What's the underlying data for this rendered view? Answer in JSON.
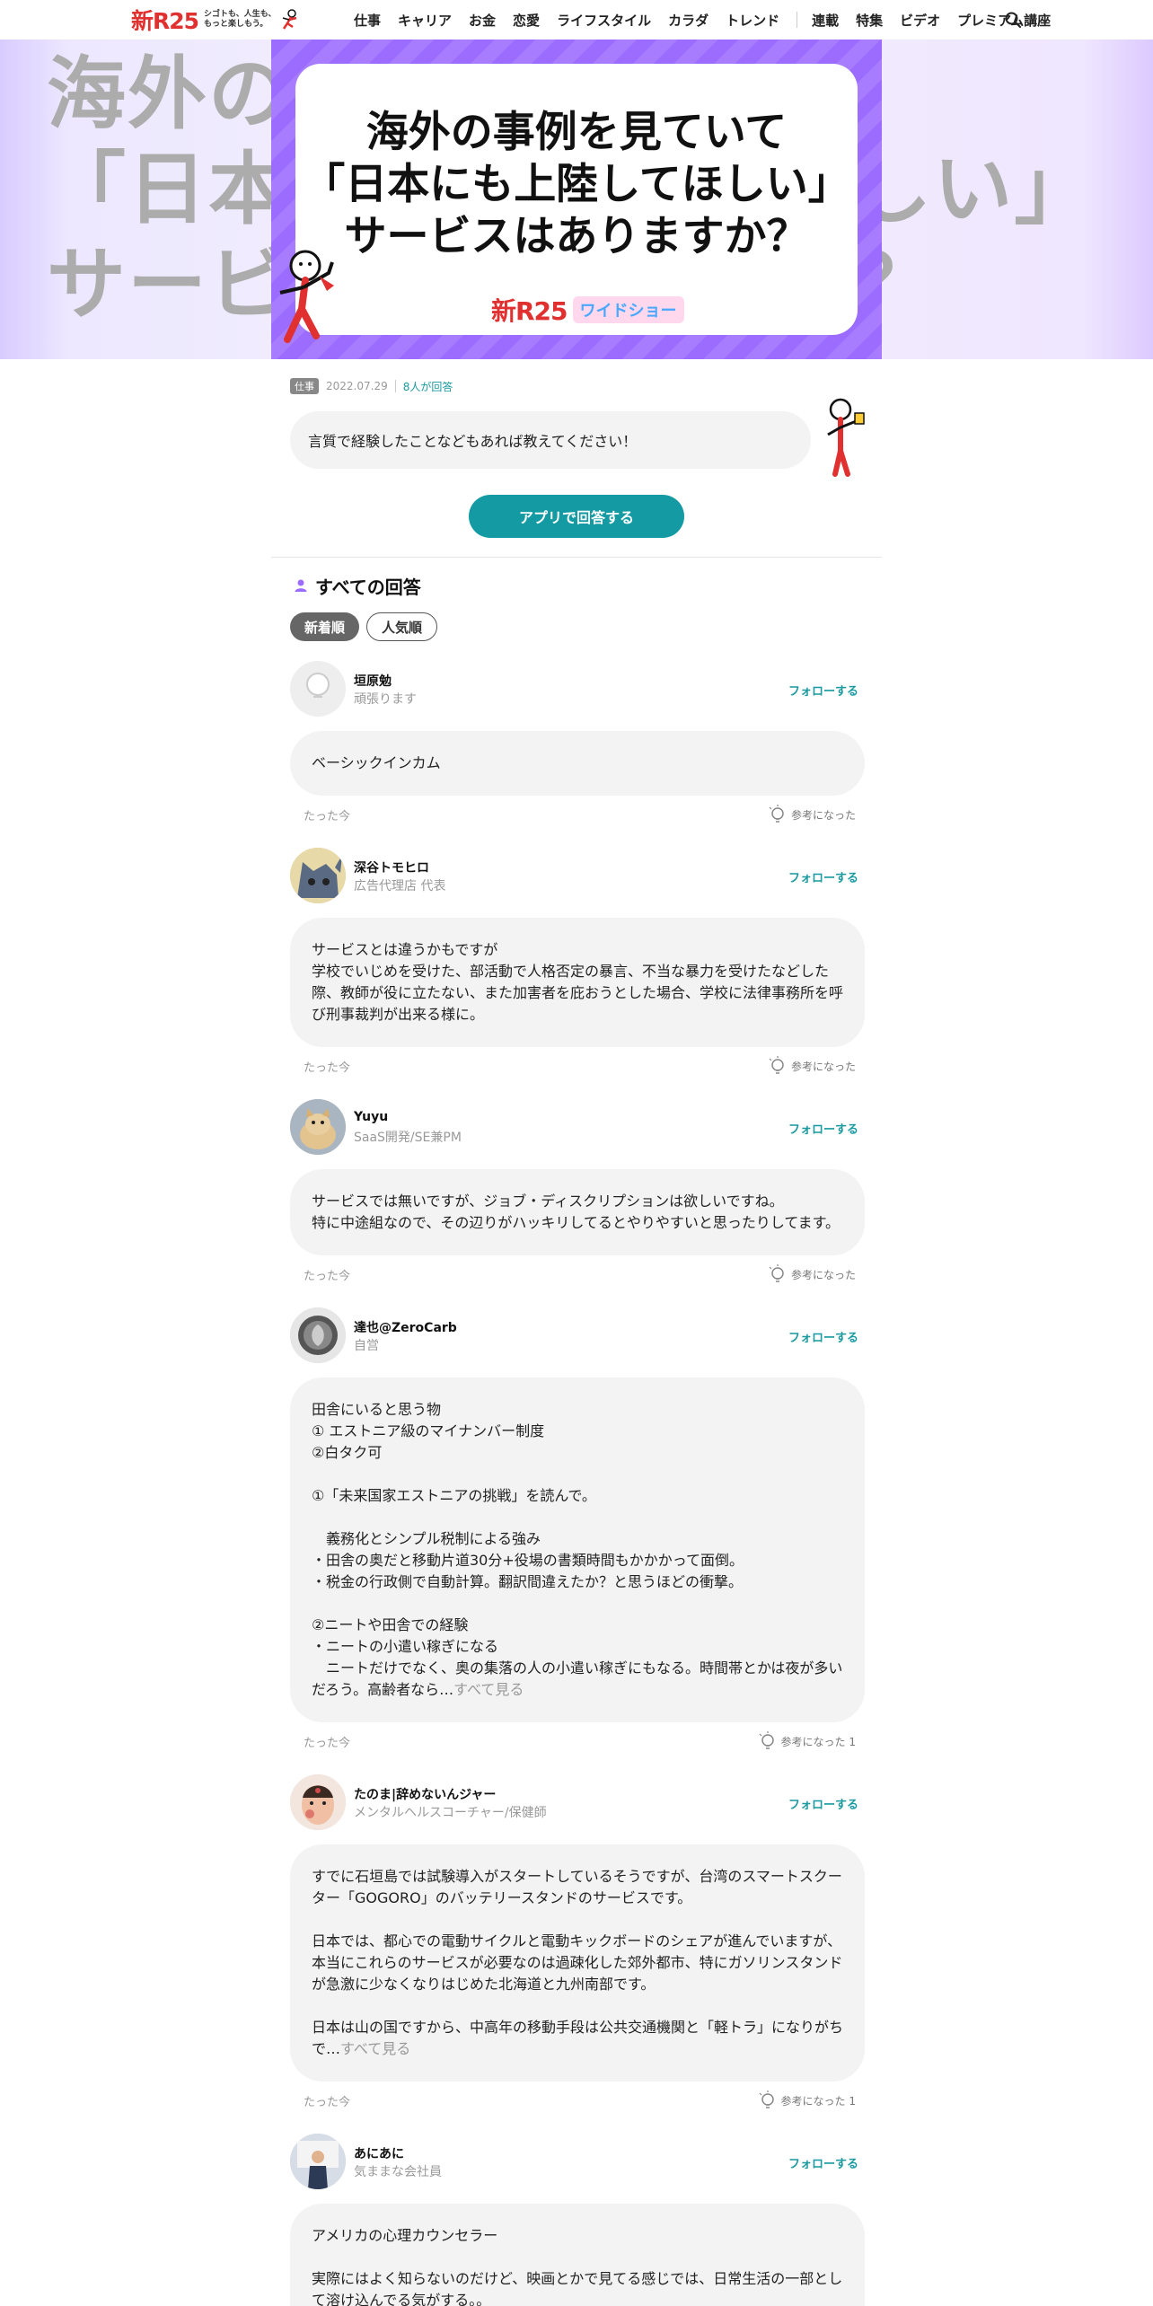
{
  "header": {
    "logo_text": "新R25",
    "logo_tagline_1": "シゴトも、人生も、",
    "logo_tagline_2": "もっと楽しもう。",
    "nav": [
      "仕事",
      "キャリア",
      "お金",
      "恋愛",
      "ライフスタイル",
      "カラダ",
      "トレンド"
    ],
    "nav2": [
      "連載",
      "特集",
      "ビデオ",
      "プレミアム講座"
    ],
    "search_icon": "search-icon"
  },
  "hero": {
    "title_line1": "海外の事例を見ていて",
    "title_line2": "「日本にも上陸してほしい」",
    "title_line3": "サービスはありますか？",
    "brand": "新R25",
    "brand_sub": "ワイドショー",
    "accent": "#9b6cff"
  },
  "question": {
    "category": "仕事",
    "date": "2022.07.29",
    "answer_count": "8人が回答",
    "prompt": "言質で経験したことなどもあれば教えてください！",
    "app_button": "アプリで回答する"
  },
  "answers_section": {
    "title": "すべての回答",
    "sort_new": "新着順",
    "sort_popular": "人気順"
  },
  "answers": [
    {
      "name": "垣原勉",
      "role": "頑張ります",
      "follow": "フォローする",
      "body": [
        "ベーシックインカム"
      ],
      "time": "たった今",
      "helpful": "参考になった"
    },
    {
      "name": "深谷トモヒロ",
      "role": "広告代理店 代表",
      "follow": "フォローする",
      "body": [
        "サービスとは違うかもですが",
        "学校でいじめを受けた、部活動で人格否定の暴言、不当な暴力を受けたなどした",
        "際、教師が役に立たない、また加害者を庇おうとした場合、学校に法律事務所を呼",
        "び刑事裁判が出来る様に。"
      ],
      "time": "たった今",
      "helpful": "参考になった"
    },
    {
      "name": "Yuyu",
      "role": "SaaS開発/SE兼PM",
      "follow": "フォローする",
      "body": [
        "サービスでは無いですが、ジョブ・ディスクリプションは欲しいですね。",
        "特に中途組なので、その辺りがハッキリしてるとやりやすいと思ったりしてます。"
      ],
      "time": "たった今",
      "helpful": "参考になった"
    },
    {
      "name": "達也@ZeroCarb",
      "role": "自営",
      "follow": "フォローする",
      "body": [
        "田舎にいると思う物",
        "① エストニア級のマイナンバー制度",
        "②白タク可",
        "",
        "①「未来国家エストニアの挑戦」を読んで。",
        "",
        "　義務化とシンプル税制による強み",
        "・田舎の奥だと移動片道30分+役場の書類時間もかかかって面倒。",
        "・税金の行政側で自動計算。翻訳間違えたか？と思うほどの衝撃。",
        "",
        "②ニートや田舎での経験",
        "・ニートの小遣い稼ぎになる",
        "　ニートだけでなく、奥の集落の人の小遣い稼ぎにもなる。時間帯とかは夜が多い",
        "だろう。高齢者なら…"
      ],
      "see_all": "すべて見る",
      "time": "たった今",
      "helpful": "参考になった 1"
    },
    {
      "name": "たのま|辞めないんジャー",
      "role": "メンタルヘルスコーチャー/保健師",
      "follow": "フォローする",
      "body": [
        "すでに石垣島では試験導入がスタートしているそうですが、台湾のスマートスクー",
        "ター「GOGORO」のバッテリースタンドのサービスです。",
        "",
        "日本では、都心での電動サイクルと電動キックボードのシェアが進んでいますが、",
        "本当にこれらのサービスが必要なのは過疎化した郊外都市、特にガソリンスタンド",
        "が急激に少なくなりはじめた北海道と九州南部です。",
        "",
        "日本は山の国ですから、中高年の移動手段は公共交通機関と「軽トラ」になりがち",
        "で…"
      ],
      "see_all": "すべて見る",
      "time": "たった今",
      "helpful": "参考になった 1"
    },
    {
      "name": "あにあに",
      "role": "気ままな会社員",
      "follow": "フォローする",
      "body": [
        "アメリカの心理カウンセラー",
        "",
        "実際にはよく知らないのだけど、映画とかで見てる感じでは、日常生活の一部とし",
        "て溶け込んでる気がする。。"
      ]
    }
  ]
}
